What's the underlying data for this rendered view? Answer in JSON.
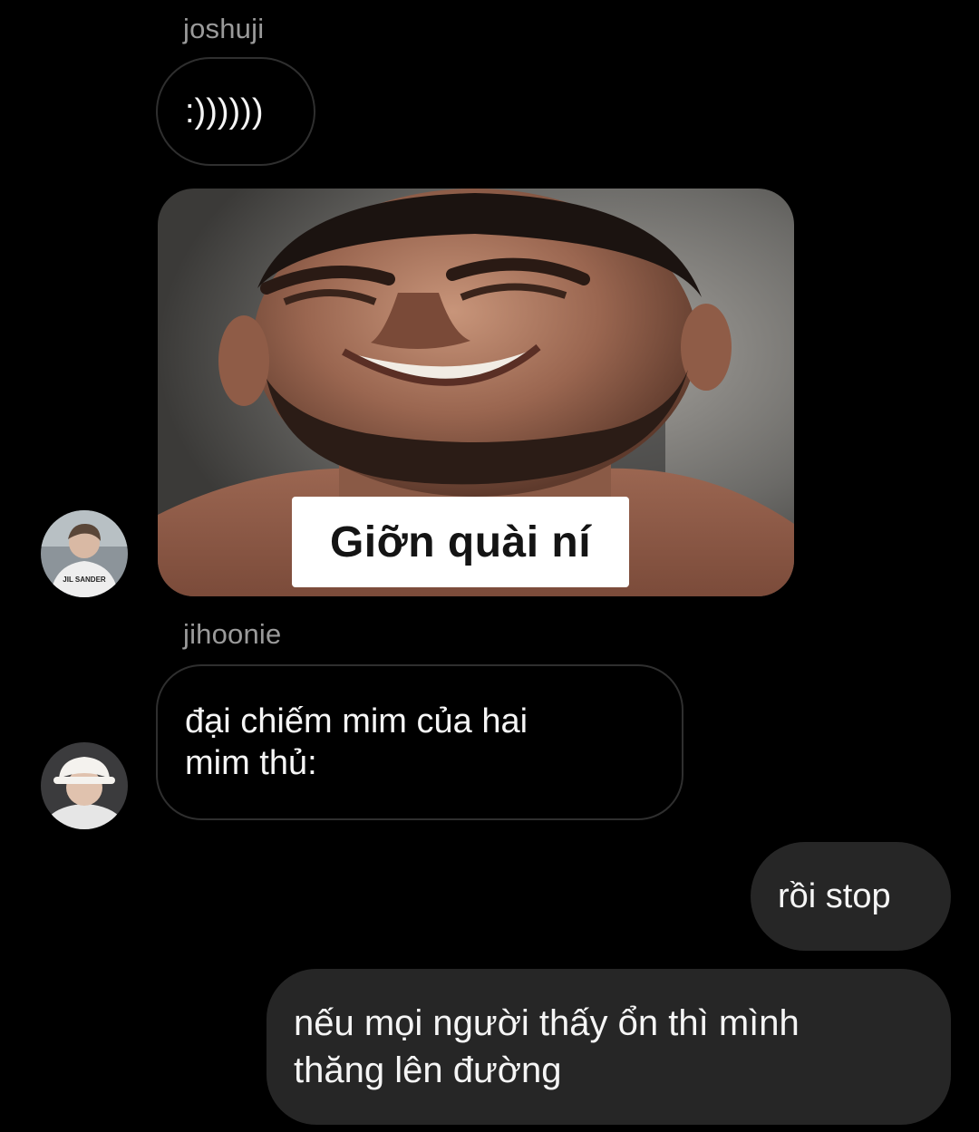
{
  "thread": {
    "messages": [
      {
        "sender": "joshuji",
        "text": ":))))))"
      },
      {
        "sender": "joshuji",
        "image_caption": "Giỡn quài ní"
      },
      {
        "sender": "jihoonie",
        "text": "đại chiếm mim của hai\nmim thủ:"
      },
      {
        "sender": "me",
        "text": "rồi stop"
      },
      {
        "sender": "me",
        "text": "nếu mọi người thấy ổn thì mình\nthăng lên đường"
      }
    ]
  },
  "avatars": {
    "joshuji_shirt_text": "JIL SANDER"
  },
  "colors": {
    "background": "#000000",
    "incoming_border": "#2f2f2f",
    "outgoing_bubble": "#262626",
    "sender_name": "#9a9a9a",
    "text": "#f5f5f5"
  }
}
